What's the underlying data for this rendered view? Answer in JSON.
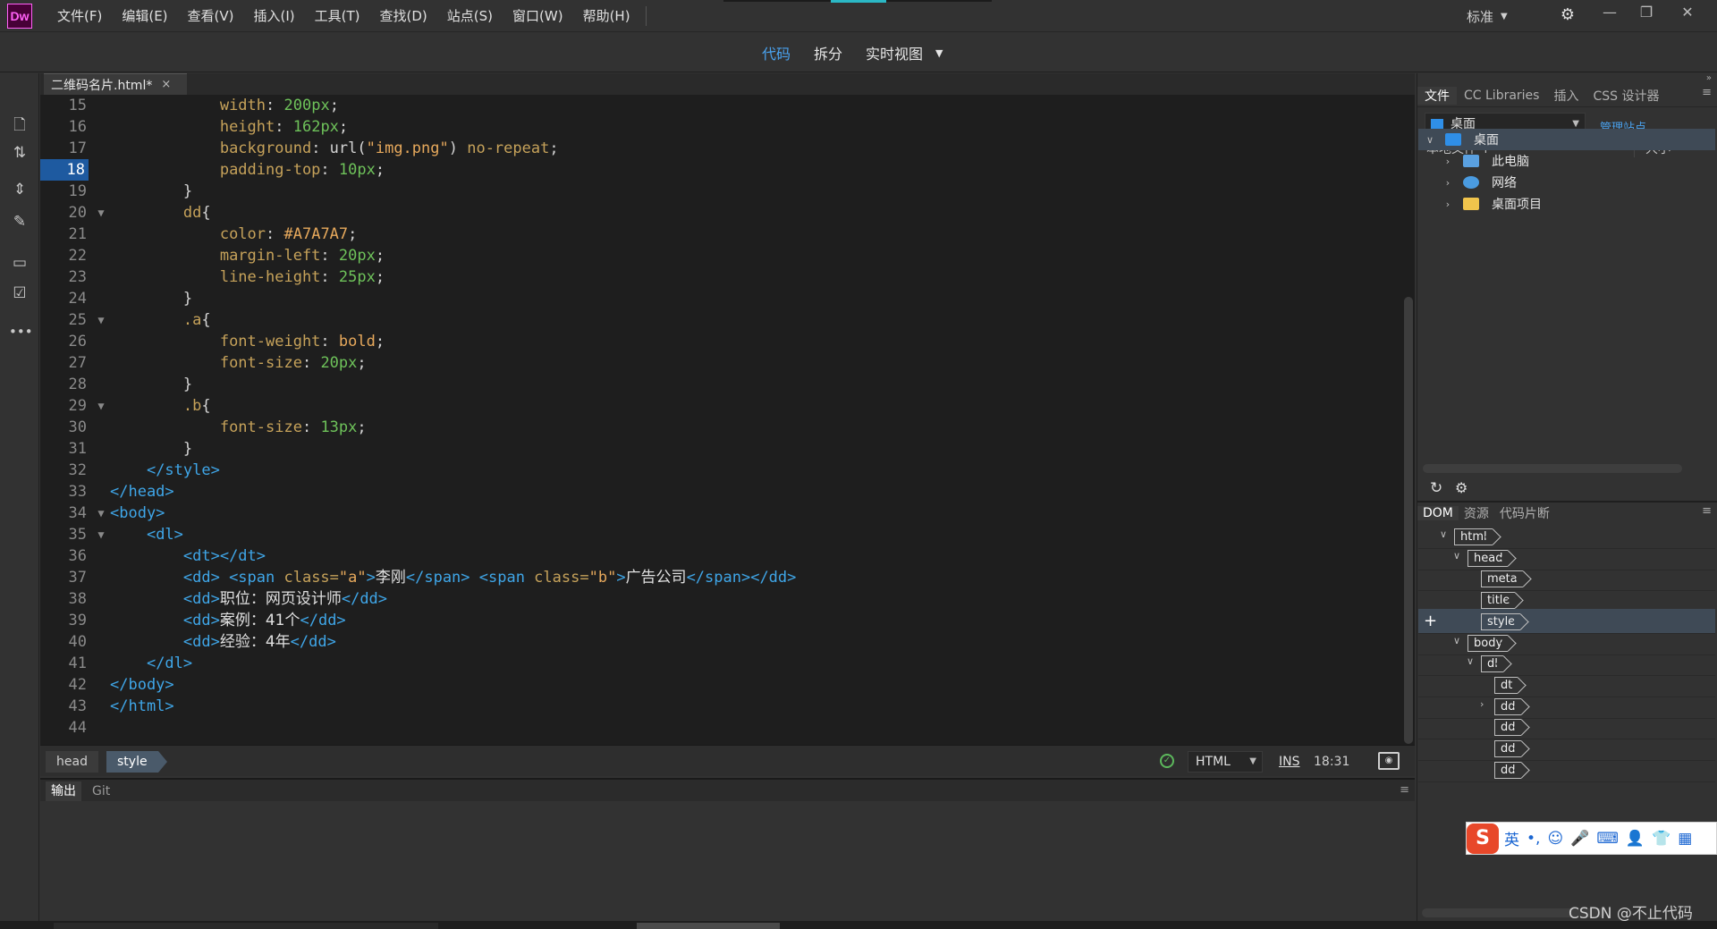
{
  "app": {
    "logo": "Dw",
    "menu": [
      "文件(F)",
      "编辑(E)",
      "查看(V)",
      "插入(I)",
      "工具(T)",
      "查找(D)",
      "站点(S)",
      "窗口(W)",
      "帮助(H)"
    ],
    "workspace": "标准",
    "window_controls": [
      "—",
      "❐",
      "✕"
    ]
  },
  "view_bar": {
    "tabs": [
      {
        "label": "代码",
        "active": true
      },
      {
        "label": "拆分",
        "active": false
      },
      {
        "label": "实时视图",
        "active": false
      }
    ]
  },
  "left_toolbar": {
    "icons": [
      "file-icon",
      "sync-icon",
      "expand-icon",
      "format-brush-icon",
      "comment-icon",
      "validate-icon",
      "more-icon"
    ]
  },
  "document": {
    "tab_title": "二维码名片.html*",
    "close_label": "×",
    "current_line": 18,
    "lines": [
      {
        "n": "15",
        "fold": "",
        "tokens": [
          {
            "t": "            ",
            "c": "plain"
          },
          {
            "t": "width",
            "c": "prop"
          },
          {
            "t": ": ",
            "c": "plain"
          },
          {
            "t": "200px",
            "c": "num"
          },
          {
            "t": ";",
            "c": "plain"
          }
        ]
      },
      {
        "n": "16",
        "fold": "",
        "tokens": [
          {
            "t": "            ",
            "c": "plain"
          },
          {
            "t": "height",
            "c": "prop"
          },
          {
            "t": ": ",
            "c": "plain"
          },
          {
            "t": "162px",
            "c": "num"
          },
          {
            "t": ";",
            "c": "plain"
          }
        ]
      },
      {
        "n": "17",
        "fold": "",
        "tokens": [
          {
            "t": "            ",
            "c": "plain"
          },
          {
            "t": "background",
            "c": "prop"
          },
          {
            "t": ": url(",
            "c": "plain"
          },
          {
            "t": "\"img.png\"",
            "c": "str"
          },
          {
            "t": ") ",
            "c": "plain"
          },
          {
            "t": "no-repeat",
            "c": "prop"
          },
          {
            "t": ";",
            "c": "plain"
          }
        ]
      },
      {
        "n": "18",
        "fold": "",
        "tokens": [
          {
            "t": "            ",
            "c": "plain"
          },
          {
            "t": "padding-top",
            "c": "prop"
          },
          {
            "t": ": ",
            "c": "plain"
          },
          {
            "t": "10px",
            "c": "num"
          },
          {
            "t": ";",
            "c": "plain"
          }
        ]
      },
      {
        "n": "19",
        "fold": "",
        "tokens": [
          {
            "t": "        }",
            "c": "plain"
          }
        ]
      },
      {
        "n": "20",
        "fold": "▼",
        "tokens": [
          {
            "t": "        ",
            "c": "plain"
          },
          {
            "t": "dd",
            "c": "sel"
          },
          {
            "t": "{",
            "c": "plain"
          }
        ]
      },
      {
        "n": "21",
        "fold": "",
        "tokens": [
          {
            "t": "            ",
            "c": "plain"
          },
          {
            "t": "color",
            "c": "prop"
          },
          {
            "t": ": ",
            "c": "plain"
          },
          {
            "t": "#A7A7A7",
            "c": "str"
          },
          {
            "t": ";",
            "c": "plain"
          }
        ]
      },
      {
        "n": "22",
        "fold": "",
        "tokens": [
          {
            "t": "            ",
            "c": "plain"
          },
          {
            "t": "margin-left",
            "c": "prop"
          },
          {
            "t": ": ",
            "c": "plain"
          },
          {
            "t": "20px",
            "c": "num"
          },
          {
            "t": ";",
            "c": "plain"
          }
        ]
      },
      {
        "n": "23",
        "fold": "",
        "tokens": [
          {
            "t": "            ",
            "c": "plain"
          },
          {
            "t": "line-height",
            "c": "prop"
          },
          {
            "t": ": ",
            "c": "plain"
          },
          {
            "t": "25px",
            "c": "num"
          },
          {
            "t": ";",
            "c": "plain"
          }
        ]
      },
      {
        "n": "24",
        "fold": "",
        "tokens": [
          {
            "t": "        }",
            "c": "plain"
          }
        ]
      },
      {
        "n": "25",
        "fold": "▼",
        "tokens": [
          {
            "t": "        ",
            "c": "plain"
          },
          {
            "t": ".a",
            "c": "sel"
          },
          {
            "t": "{",
            "c": "plain"
          }
        ]
      },
      {
        "n": "26",
        "fold": "",
        "tokens": [
          {
            "t": "            ",
            "c": "plain"
          },
          {
            "t": "font-weight",
            "c": "prop"
          },
          {
            "t": ": ",
            "c": "plain"
          },
          {
            "t": "bold",
            "c": "str"
          },
          {
            "t": ";",
            "c": "plain"
          }
        ]
      },
      {
        "n": "27",
        "fold": "",
        "tokens": [
          {
            "t": "            ",
            "c": "plain"
          },
          {
            "t": "font-size",
            "c": "prop"
          },
          {
            "t": ": ",
            "c": "plain"
          },
          {
            "t": "20px",
            "c": "num"
          },
          {
            "t": ";",
            "c": "plain"
          }
        ]
      },
      {
        "n": "28",
        "fold": "",
        "tokens": [
          {
            "t": "        }",
            "c": "plain"
          }
        ]
      },
      {
        "n": "29",
        "fold": "▼",
        "tokens": [
          {
            "t": "        ",
            "c": "plain"
          },
          {
            "t": ".b",
            "c": "sel"
          },
          {
            "t": "{",
            "c": "plain"
          }
        ]
      },
      {
        "n": "30",
        "fold": "",
        "tokens": [
          {
            "t": "            ",
            "c": "plain"
          },
          {
            "t": "font-size",
            "c": "prop"
          },
          {
            "t": ": ",
            "c": "plain"
          },
          {
            "t": "13px",
            "c": "num"
          },
          {
            "t": ";",
            "c": "plain"
          }
        ]
      },
      {
        "n": "31",
        "fold": "",
        "tokens": [
          {
            "t": "        }",
            "c": "plain"
          }
        ]
      },
      {
        "n": "32",
        "fold": "",
        "tokens": [
          {
            "t": "    ",
            "c": "plain"
          },
          {
            "t": "</style>",
            "c": "tag"
          }
        ]
      },
      {
        "n": "33",
        "fold": "",
        "tokens": [
          {
            "t": "</head>",
            "c": "tag"
          }
        ]
      },
      {
        "n": "34",
        "fold": "▼",
        "tokens": [
          {
            "t": "<body>",
            "c": "tag"
          }
        ]
      },
      {
        "n": "35",
        "fold": "▼",
        "tokens": [
          {
            "t": "    ",
            "c": "plain"
          },
          {
            "t": "<dl>",
            "c": "tag"
          }
        ]
      },
      {
        "n": "36",
        "fold": "",
        "tokens": [
          {
            "t": "        ",
            "c": "plain"
          },
          {
            "t": "<dt></dt>",
            "c": "tag"
          }
        ]
      },
      {
        "n": "37",
        "fold": "",
        "tokens": [
          {
            "t": "        ",
            "c": "plain"
          },
          {
            "t": "<dd> <span ",
            "c": "tag"
          },
          {
            "t": "class=",
            "c": "attr"
          },
          {
            "t": "\"a\"",
            "c": "str"
          },
          {
            "t": ">",
            "c": "tag"
          },
          {
            "t": "李刚",
            "c": "cn"
          },
          {
            "t": "</span> <span ",
            "c": "tag"
          },
          {
            "t": "class=",
            "c": "attr"
          },
          {
            "t": "\"b\"",
            "c": "str"
          },
          {
            "t": ">",
            "c": "tag"
          },
          {
            "t": "广告公司",
            "c": "cn"
          },
          {
            "t": "</span></dd>",
            "c": "tag"
          }
        ]
      },
      {
        "n": "38",
        "fold": "",
        "tokens": [
          {
            "t": "        ",
            "c": "plain"
          },
          {
            "t": "<dd>",
            "c": "tag"
          },
          {
            "t": "职位：网页设计师",
            "c": "cn"
          },
          {
            "t": "</dd>",
            "c": "tag"
          }
        ]
      },
      {
        "n": "39",
        "fold": "",
        "tokens": [
          {
            "t": "        ",
            "c": "plain"
          },
          {
            "t": "<dd>",
            "c": "tag"
          },
          {
            "t": "案例：41个",
            "c": "cn"
          },
          {
            "t": "</dd>",
            "c": "tag"
          }
        ]
      },
      {
        "n": "40",
        "fold": "",
        "tokens": [
          {
            "t": "        ",
            "c": "plain"
          },
          {
            "t": "<dd>",
            "c": "tag"
          },
          {
            "t": "经验：4年",
            "c": "cn"
          },
          {
            "t": "</dd>",
            "c": "tag"
          }
        ]
      },
      {
        "n": "41",
        "fold": "",
        "tokens": [
          {
            "t": "    ",
            "c": "plain"
          },
          {
            "t": "</dl>",
            "c": "tag"
          }
        ]
      },
      {
        "n": "42",
        "fold": "",
        "tokens": [
          {
            "t": "</body>",
            "c": "tag"
          }
        ]
      },
      {
        "n": "43",
        "fold": "",
        "tokens": [
          {
            "t": "</html>",
            "c": "tag"
          }
        ]
      },
      {
        "n": "44",
        "fold": "",
        "tokens": []
      }
    ]
  },
  "status": {
    "breadcrumbs": [
      "head",
      "style"
    ],
    "language": "HTML",
    "mode": "INS",
    "cursor_pos": "18:31"
  },
  "output_panel": {
    "tabs": [
      "输出",
      "Git"
    ]
  },
  "files_panel": {
    "tabs": [
      "文件",
      "CC Libraries",
      "插入",
      "CSS 设计器"
    ],
    "site": "桌面",
    "manage_site": "管理站点",
    "col_local": "本地文件 ↑",
    "col_size": "大小",
    "tree": [
      {
        "label": "桌面",
        "chev": "∨",
        "icon": "desktop-icon",
        "indent": 0,
        "selected": true
      },
      {
        "label": "此电脑",
        "chev": "›",
        "icon": "computer-icon",
        "indent": 1,
        "selected": false
      },
      {
        "label": "网络",
        "chev": "›",
        "icon": "network-icon",
        "indent": 1,
        "selected": false
      },
      {
        "label": "桌面项目",
        "chev": "›",
        "icon": "folder-icon",
        "indent": 1,
        "selected": false
      }
    ]
  },
  "dom_panel": {
    "tabs": [
      "DOM",
      "资源",
      "代码片断"
    ],
    "nodes": [
      {
        "label": "html",
        "level": 0,
        "chev": "∨",
        "selected": false
      },
      {
        "label": "head",
        "level": 1,
        "chev": "∨",
        "selected": false
      },
      {
        "label": "meta",
        "level": 2,
        "chev": "",
        "selected": false
      },
      {
        "label": "title",
        "level": 2,
        "chev": "",
        "selected": false
      },
      {
        "label": "style",
        "level": 2,
        "chev": "",
        "selected": true
      },
      {
        "label": "body",
        "level": 1,
        "chev": "∨",
        "selected": false
      },
      {
        "label": "dl",
        "level": 2,
        "chev": "∨",
        "selected": false
      },
      {
        "label": "dt",
        "level": 3,
        "chev": "",
        "selected": false
      },
      {
        "label": "dd",
        "level": 3,
        "chev": "›",
        "selected": false
      },
      {
        "label": "dd",
        "level": 3,
        "chev": "",
        "selected": false
      },
      {
        "label": "dd",
        "level": 3,
        "chev": "",
        "selected": false
      },
      {
        "label": "dd",
        "level": 3,
        "chev": "",
        "selected": false
      }
    ]
  },
  "ime": {
    "logo": "S",
    "lang": "英",
    "items": [
      "•,",
      "☺",
      "🎤",
      "⌨",
      "👤",
      "👕",
      "▦"
    ]
  },
  "watermark": "CSDN @不止代码",
  "colors": {
    "accent": "#4aa3f0",
    "tag": "#3fa6e8",
    "property": "#c6a25a",
    "number": "#6ec25a",
    "string": "#e7a95c"
  }
}
